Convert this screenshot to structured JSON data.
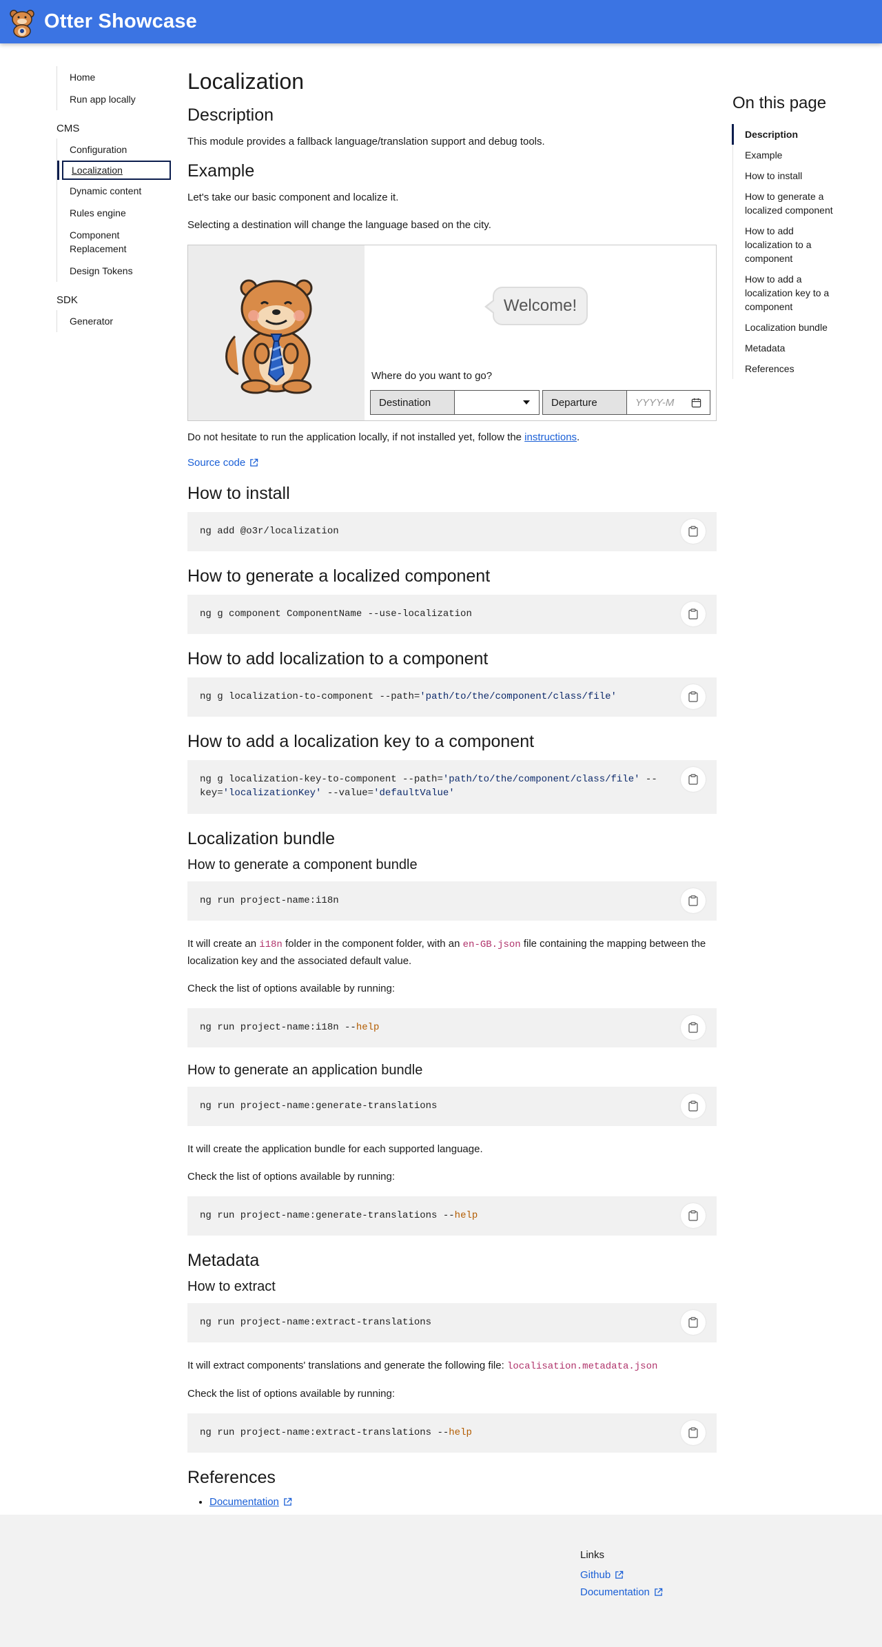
{
  "header": {
    "brand": "Otter Showcase",
    "logo_icon": "otter-logo"
  },
  "sidebar": {
    "top": [
      "Home",
      "Run app locally"
    ],
    "cms_heading": "CMS",
    "cms": [
      "Configuration",
      "Localization",
      "Dynamic content",
      "Rules engine",
      "Component Replacement",
      "Design Tokens"
    ],
    "sdk_heading": "SDK",
    "sdk": [
      "Generator"
    ]
  },
  "page": {
    "title": "Localization",
    "description_heading": "Description",
    "description": "This module provides a fallback language/translation support and debug tools.",
    "example_heading": "Example",
    "example_p1": "Let's take our basic component and localize it.",
    "example_p2": "Selecting a destination will change the language based on the city.",
    "demo": {
      "welcome": "Welcome!",
      "question": "Where do you want to go?",
      "destination_label": "Destination",
      "destination_value": "",
      "departure_label": "Departure",
      "departure_placeholder": "YYYY-M"
    },
    "run_locally_pre": "Do not hesitate to run the application locally, if not installed yet, follow the ",
    "run_locally_link": "instructions",
    "run_locally_post": ".",
    "source_code": "Source code",
    "install_heading": "How to install",
    "install_cmd": "ng add @o3r/localization",
    "gen_component_heading": "How to generate a localized component",
    "gen_component_cmd": "ng g component ComponentName --use-localization",
    "add_loc_heading": "How to add localization to a component",
    "add_loc_cmd_pre": "ng g localization-to-component --path=",
    "add_loc_cmd_str": "'path/to/the/component/class/file'",
    "add_key_heading": "How to add a localization key to a component",
    "add_key_cmd_pre": "ng g localization-key-to-component --path=",
    "add_key_cmd_str1": "'path/to/the/component/class/file'",
    "add_key_cmd_mid1": " --key=",
    "add_key_cmd_str2": "'localizationKey'",
    "add_key_cmd_mid2": " --value=",
    "add_key_cmd_str3": "'defaultValue'",
    "bundle_heading": "Localization bundle",
    "comp_bundle_heading": "How to generate a component bundle",
    "comp_bundle_cmd": "ng run project-name:i18n",
    "comp_bundle_p_pre": "It will create an ",
    "comp_bundle_code1": "i18n",
    "comp_bundle_p_mid": " folder in the component folder, with an ",
    "comp_bundle_code2": "en-GB.json",
    "comp_bundle_p_post": " file containing the mapping between the localization key and the associated default value.",
    "check_options": "Check the list of options available by running:",
    "comp_bundle_help_pre": "ng run project-name:i18n --",
    "help_kw": "help",
    "app_bundle_heading": "How to generate an application bundle",
    "app_bundle_cmd": "ng run project-name:generate-translations",
    "app_bundle_p": "It will create the application bundle for each supported language.",
    "app_bundle_help_pre": "ng run project-name:generate-translations --",
    "metadata_heading": "Metadata",
    "extract_heading": "How to extract",
    "extract_cmd": "ng run project-name:extract-translations",
    "extract_p_pre": "It will extract components' translations and generate the following file: ",
    "extract_code": "localisation.metadata.json",
    "extract_help_pre": "ng run project-name:extract-translations --",
    "references_heading": "References",
    "references": [
      "Documentation"
    ]
  },
  "toc": {
    "title": "On this page",
    "items": [
      "Description",
      "Example",
      "How to install",
      "How to generate a localized component",
      "How to add localization to a component",
      "How to add a localization key to a component",
      "Localization bundle",
      "Metadata",
      "References"
    ]
  },
  "footer": {
    "heading": "Links",
    "links": [
      "Github",
      "Documentation"
    ]
  },
  "colors": {
    "header": "#3b74e3",
    "link": "#1a5fd6",
    "accent": "#0b1d4d"
  }
}
